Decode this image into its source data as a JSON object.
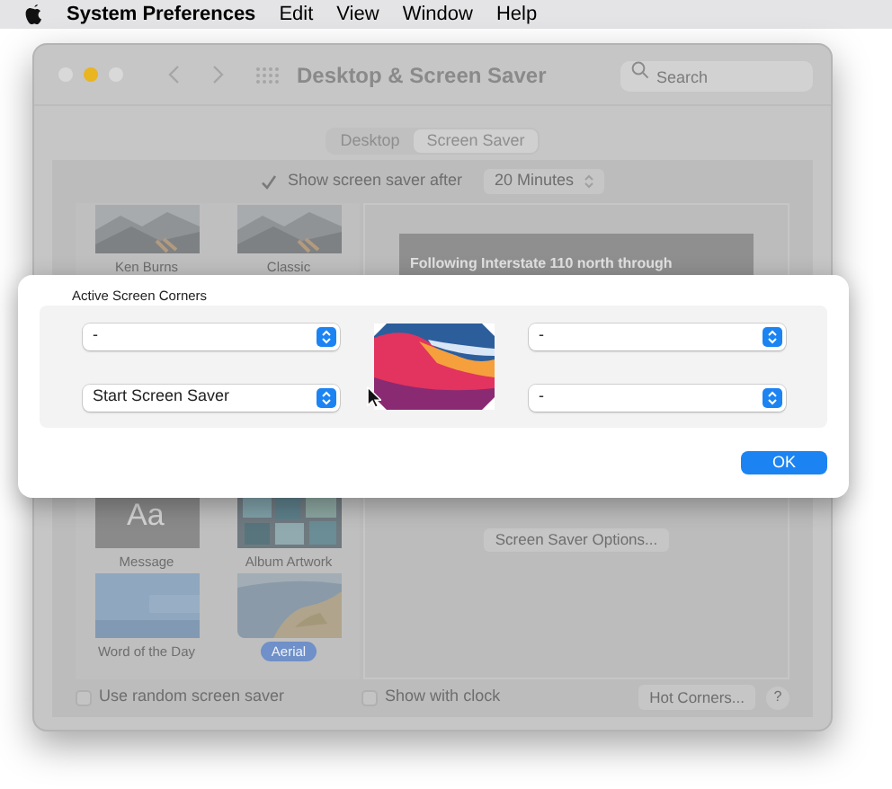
{
  "menu_bar": {
    "items": [
      "System Preferences",
      "Edit",
      "View",
      "Window",
      "Help"
    ]
  },
  "window": {
    "title": "Desktop & Screen Saver",
    "search": {
      "placeholder": "Search"
    },
    "tabs": [
      {
        "label": "Desktop",
        "selected": false
      },
      {
        "label": "Screen Saver",
        "selected": true
      }
    ],
    "show_after": {
      "checked": true,
      "label": "Show screen saver after",
      "value": "20 Minutes"
    },
    "savers": [
      {
        "label": "Ken Burns",
        "kind": "mountains",
        "selected": false
      },
      {
        "label": "Classic",
        "kind": "mountains",
        "selected": false
      },
      {
        "label": "Message",
        "kind": "message",
        "text": "Aa",
        "selected": false
      },
      {
        "label": "Album Artwork",
        "kind": "mosaic",
        "selected": false
      },
      {
        "label": "Word of the Day",
        "kind": "words",
        "selected": false
      },
      {
        "label": "Aerial",
        "kind": "earth",
        "selected": true
      }
    ],
    "preview_caption": "Following Interstate 110 north through",
    "options_button": "Screen Saver Options...",
    "random": {
      "label": "Use random screen saver",
      "checked": false
    },
    "clock": {
      "label": "Show with clock",
      "checked": false
    },
    "hot_corners_button": "Hot Corners...",
    "help_button": "?"
  },
  "dialog": {
    "title": "Active Screen Corners",
    "corners": [
      {
        "value": "-"
      },
      {
        "value": "-"
      },
      {
        "value": "Start Screen Saver"
      },
      {
        "value": "-"
      }
    ],
    "ok_button": "OK"
  }
}
